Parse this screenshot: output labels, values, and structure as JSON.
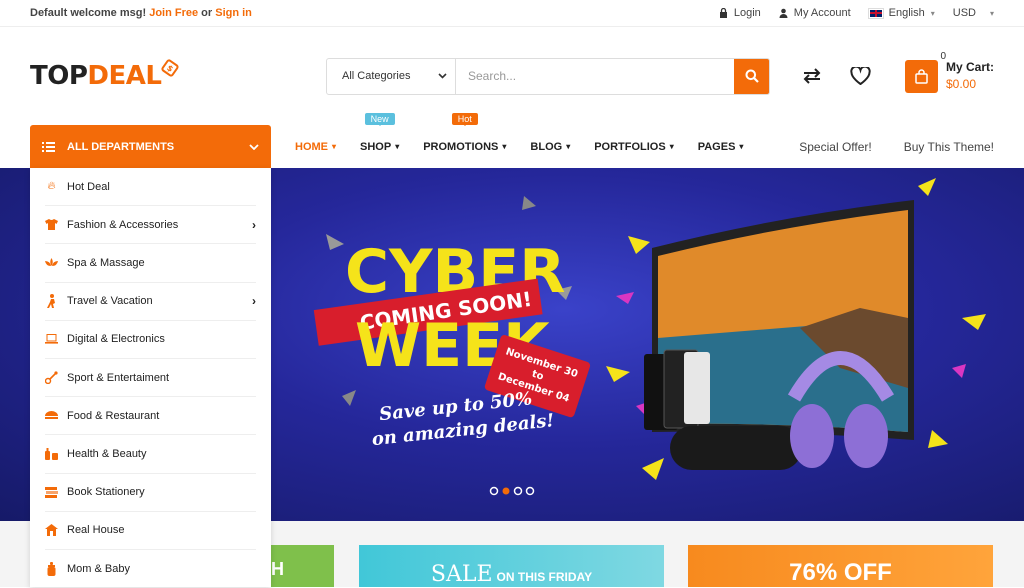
{
  "topbar": {
    "welcome": "Default welcome msg!",
    "join": "Join Free",
    "or": "or",
    "signin": "Sign in",
    "login": "Login",
    "account": "My Account",
    "language": "English",
    "currency": "USD"
  },
  "header": {
    "logo_top": "TOP",
    "logo_deal": "DEAL",
    "category_select": "All Categories",
    "search_placeholder": "Search...",
    "cart_count": "0",
    "cart_label": "My Cart:",
    "cart_total": "$0.00"
  },
  "nav": {
    "departments": "ALL DEPARTMENTS",
    "items": [
      {
        "label": "HOME",
        "badge": ""
      },
      {
        "label": "SHOP",
        "badge": "New"
      },
      {
        "label": "PROMOTIONS",
        "badge": "Hot"
      },
      {
        "label": "BLOG",
        "badge": ""
      },
      {
        "label": "PORTFOLIOS",
        "badge": ""
      },
      {
        "label": "PAGES",
        "badge": ""
      }
    ],
    "special_offer": "Special Offer!",
    "buy_theme": "Buy This Theme!"
  },
  "sidebar": {
    "items": [
      {
        "label": "Hot Deal",
        "icon": "fire-icon"
      },
      {
        "label": "Fashion & Accessories",
        "icon": "shirt-icon"
      },
      {
        "label": "Spa & Massage",
        "icon": "lotus-icon"
      },
      {
        "label": "Travel & Vacation",
        "icon": "traveler-icon"
      },
      {
        "label": "Digital & Electronics",
        "icon": "laptop-icon"
      },
      {
        "label": "Sport & Entertaiment",
        "icon": "sport-icon"
      },
      {
        "label": "Food & Restaurant",
        "icon": "food-icon"
      },
      {
        "label": "Health & Beauty",
        "icon": "beauty-icon"
      },
      {
        "label": "Book Stationery",
        "icon": "book-icon"
      },
      {
        "label": "Real House",
        "icon": "house-icon"
      },
      {
        "label": "Mom & Baby",
        "icon": "baby-bottle-icon"
      }
    ]
  },
  "banner": {
    "line1": "CYBER",
    "ribbon": "COMING SOON!",
    "line2": "WEEK",
    "tag_line1": "November 30",
    "tag_line2": "to",
    "tag_line3": "December 04",
    "save1": "Save up to 50%",
    "save2": "on amazing deals!",
    "slides": 4,
    "active_slide": 2
  },
  "promos": {
    "green_text": "H",
    "blue_main": "SALE",
    "blue_small": "ON THIS FRIDAY",
    "orange_text": "76% OFF"
  },
  "colors": {
    "accent": "#f36b09",
    "banner_bg": "#25279a",
    "new_badge": "#5bc0de"
  }
}
